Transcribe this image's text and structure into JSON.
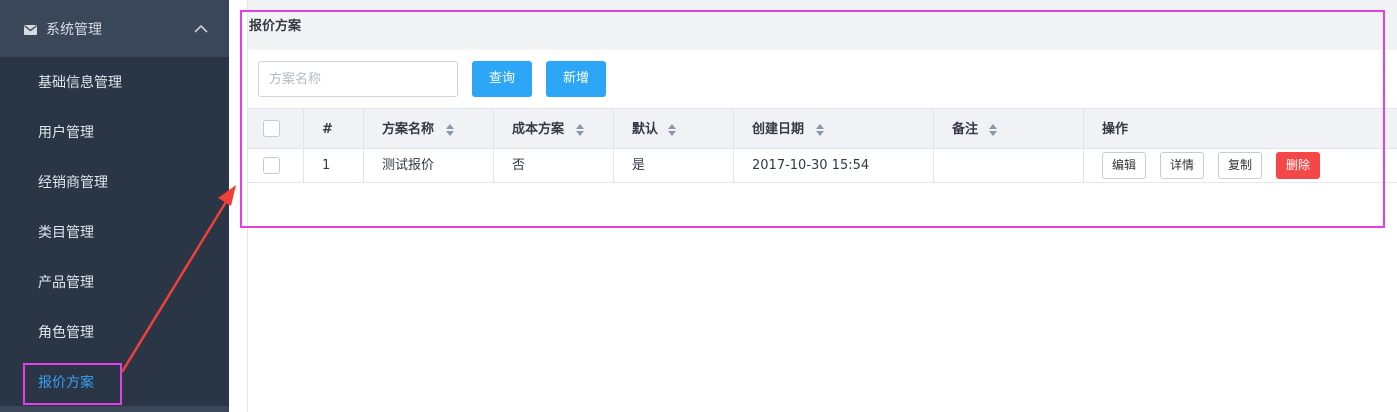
{
  "sidebar": {
    "group_title": "系统管理",
    "items": [
      {
        "label": "基础信息管理"
      },
      {
        "label": "用户管理"
      },
      {
        "label": "经销商管理"
      },
      {
        "label": "类目管理"
      },
      {
        "label": "产品管理"
      },
      {
        "label": "角色管理"
      },
      {
        "label": "报价方案"
      }
    ],
    "active_item": "报价方案"
  },
  "page": {
    "title": "报价方案"
  },
  "toolbar": {
    "search_placeholder": "方案名称",
    "search_value": "",
    "query_label": "查询",
    "add_label": "新增"
  },
  "table": {
    "headers": {
      "index": "#",
      "name": "方案名称",
      "cost_plan": "成本方案",
      "default": "默认",
      "created": "创建日期",
      "remark": "备注",
      "actions": "操作"
    },
    "rows": [
      {
        "index": "1",
        "name": "测试报价",
        "cost_plan": "否",
        "default": "是",
        "created": "2017-10-30 15:54",
        "remark": ""
      }
    ],
    "row_actions": {
      "edit": "编辑",
      "detail": "详情",
      "copy": "复制",
      "delete": "删除"
    }
  },
  "colors": {
    "sidebar_bg": "#2a3546",
    "accent": "#2da6f7",
    "danger": "#f44848",
    "highlight": "#e43fe6",
    "arrow": "#f0403a"
  }
}
